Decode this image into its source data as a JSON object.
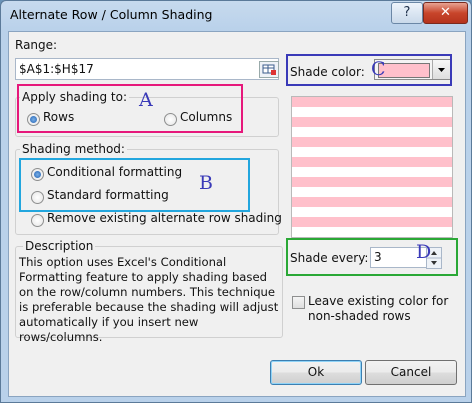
{
  "window": {
    "title": "Alternate Row / Column Shading",
    "help_label": "?",
    "close_label": "✕"
  },
  "range": {
    "label": "Range:",
    "value": "$A$1:$H$17"
  },
  "apply_shading": {
    "legend": "Apply shading to:",
    "rows_label": "Rows",
    "columns_label": "Columns",
    "selected": "Rows"
  },
  "shading_method": {
    "legend": "Shading method:",
    "conditional_label": "Conditional formatting",
    "standard_label": "Standard formatting",
    "remove_label": "Remove existing alternate row shading",
    "selected": "Conditional formatting"
  },
  "description": {
    "legend": "Description",
    "text": "This option uses Excel's Conditional Formatting feature to apply shading based on the row/column numbers. This technique is preferable because the shading will adjust automatically if you insert new rows/columns."
  },
  "shade_color": {
    "label": "Shade color:",
    "color": "#ffc0cb"
  },
  "shade_every": {
    "label": "Shade every:",
    "value": "3"
  },
  "leave_existing": {
    "label": "Leave existing color for non-shaded rows",
    "checked": false
  },
  "preview": {
    "pattern": [
      "shaded",
      "white",
      "shaded",
      "white",
      "shaded",
      "white",
      "shaded",
      "white",
      "shaded",
      "white",
      "shaded",
      "white",
      "shaded",
      "white"
    ]
  },
  "annotations": {
    "a": "A",
    "b": "B",
    "c": "C",
    "d": "D"
  },
  "annotation_colors": {
    "a": "#e6187b",
    "b": "#22a6de",
    "c": "#3a3ab8",
    "d": "#2aa836"
  },
  "buttons": {
    "ok": "Ok",
    "cancel": "Cancel"
  }
}
